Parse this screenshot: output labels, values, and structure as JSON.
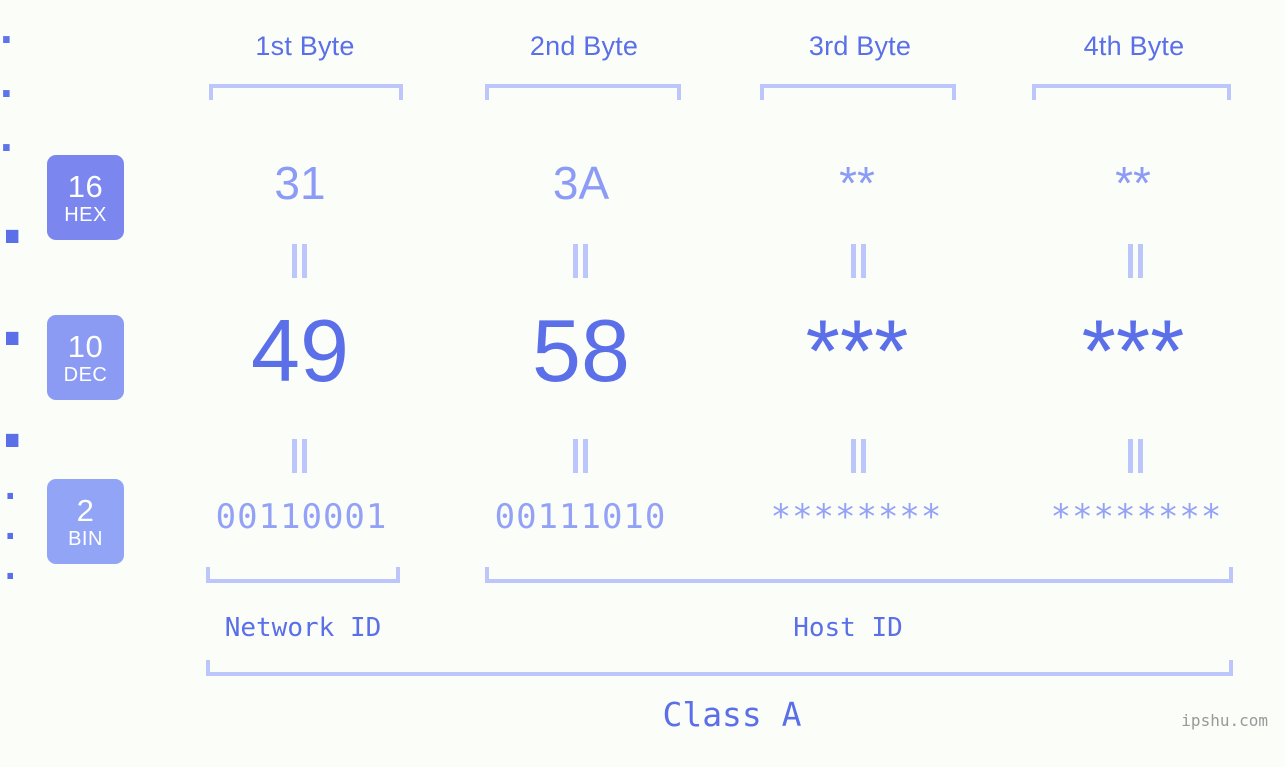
{
  "meta": {
    "background_color": "#fbfdf8",
    "accent_color": "#5a6fe8",
    "light_accent_color": "#8b9bf6",
    "bracket_color": "#bdc6fb",
    "watermark": "ipshu.com"
  },
  "byte_headers": [
    {
      "label": "1st Byte"
    },
    {
      "label": "2nd Byte"
    },
    {
      "label": "3rd Byte"
    },
    {
      "label": "4th Byte"
    }
  ],
  "radix_rows": [
    {
      "number": "16",
      "name": "HEX",
      "color": "#7c86ef"
    },
    {
      "number": "10",
      "name": "DEC",
      "color": "#8b9bf3"
    },
    {
      "number": "2",
      "name": "BIN",
      "color": "#91a4f5"
    }
  ],
  "separator": ".",
  "hex": {
    "bytes": [
      "31",
      "3A",
      "**",
      "**"
    ],
    "masked": [
      false,
      false,
      true,
      true
    ]
  },
  "dec": {
    "bytes": [
      "49",
      "58",
      "***",
      "***"
    ],
    "masked": [
      false,
      false,
      true,
      true
    ]
  },
  "bin": {
    "bytes": [
      "00110001",
      "00111010",
      "********",
      "********"
    ],
    "masked": [
      false,
      false,
      true,
      true
    ]
  },
  "sections": {
    "network_id": "Network ID",
    "host_id": "Host ID",
    "class": "Class A"
  },
  "chart_data": {
    "type": "table",
    "title": "IP Address Byte Breakdown",
    "ip_decimal": "49.58.***.***",
    "ip_hex": "31.3A.**.**",
    "ip_binary": "00110001.00111010.********.********",
    "address_class": "Class A",
    "network_id_bytes": 1,
    "host_id_bytes": 3,
    "columns": [
      "1st Byte",
      "2nd Byte",
      "3rd Byte",
      "4th Byte"
    ],
    "rows": [
      {
        "radix": "16",
        "name": "HEX",
        "values": [
          "31",
          "3A",
          "**",
          "**"
        ]
      },
      {
        "radix": "10",
        "name": "DEC",
        "values": [
          "49",
          "58",
          "***",
          "***"
        ]
      },
      {
        "radix": "2",
        "name": "BIN",
        "values": [
          "00110001",
          "00111010",
          "********",
          "********"
        ]
      }
    ]
  }
}
